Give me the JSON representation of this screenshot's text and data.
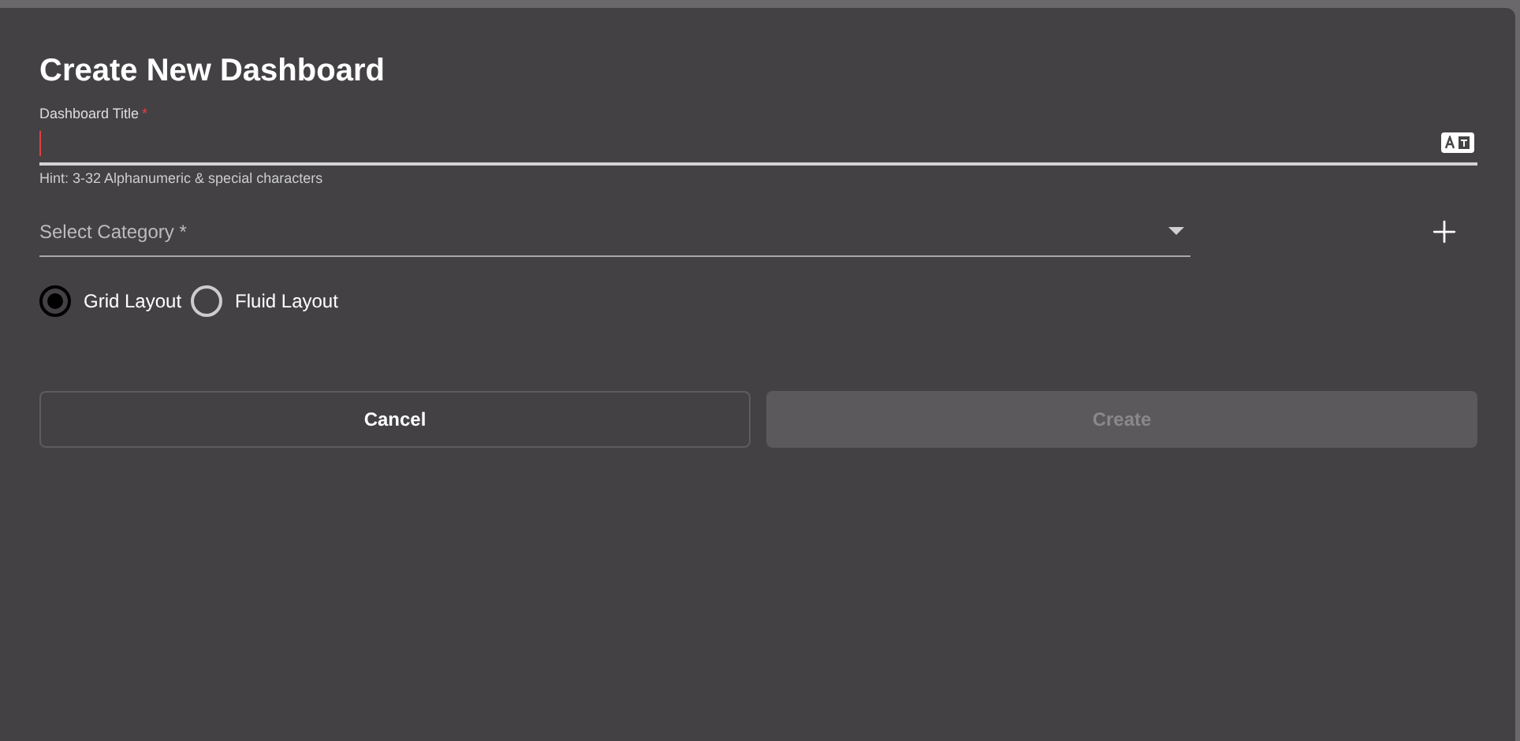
{
  "dialog": {
    "title": "Create New Dashboard",
    "title_field": {
      "label": "Dashboard Title",
      "required_mark": "*",
      "hint": "Hint: 3-32 Alphanumeric & special characters"
    },
    "category_field": {
      "placeholder": "Select Category *"
    },
    "layouts": [
      {
        "label": "Grid Layout",
        "selected": true
      },
      {
        "label": "Fluid Layout",
        "selected": false
      }
    ],
    "buttons": [
      {
        "label": "Cancel",
        "disabled": false
      },
      {
        "label": "Create",
        "disabled": true
      }
    ]
  }
}
